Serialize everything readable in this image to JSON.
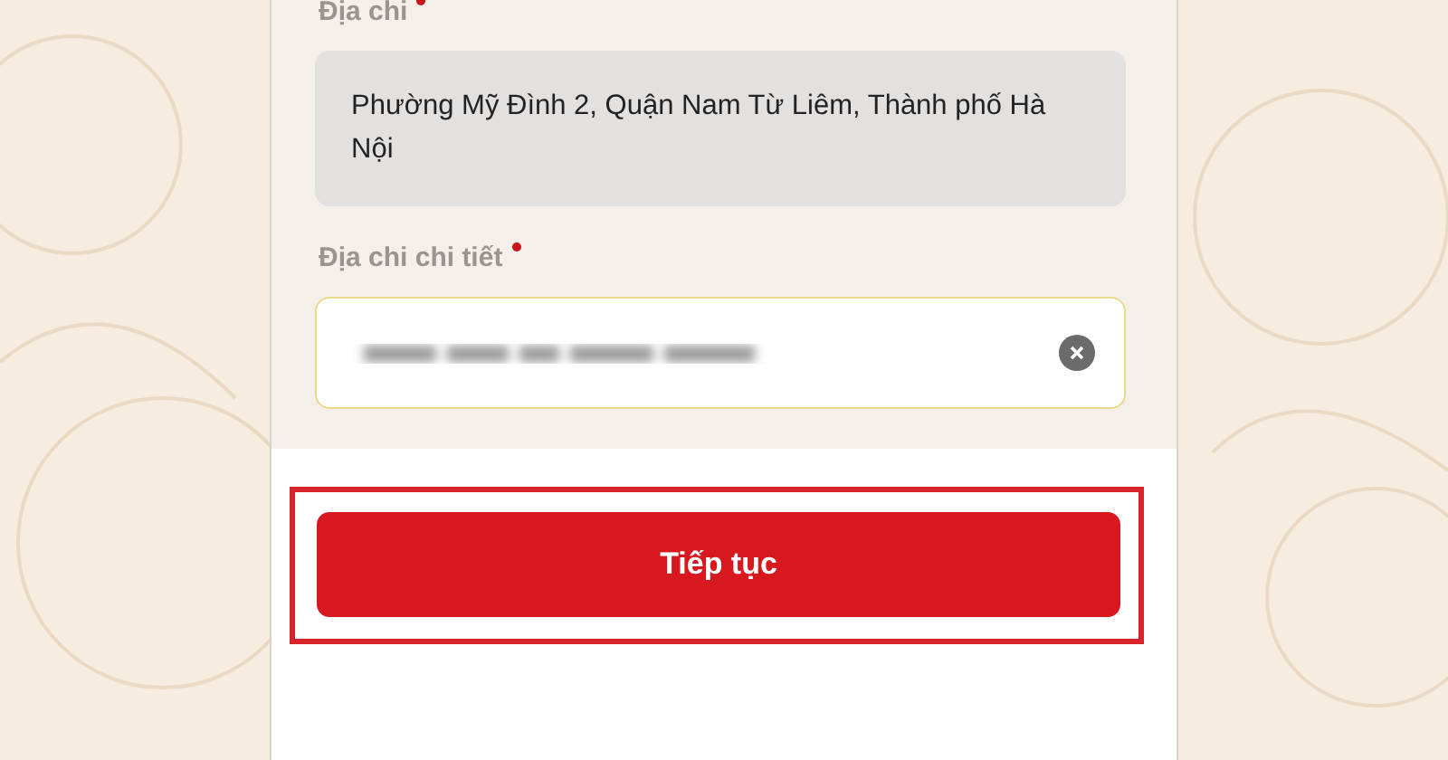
{
  "fields": [
    {
      "label": "Địa chi",
      "required": true,
      "kind": "readonly",
      "value": "Phường Mỹ Đình 2, Quận Nam Từ Liêm, Thành phố Hà Nội"
    },
    {
      "label": "Địa chi chi tiết",
      "required": true,
      "kind": "input",
      "redacted": true,
      "clearable": true
    }
  ],
  "continue_button": {
    "label": "Tiếp tục",
    "highlighted": true
  }
}
